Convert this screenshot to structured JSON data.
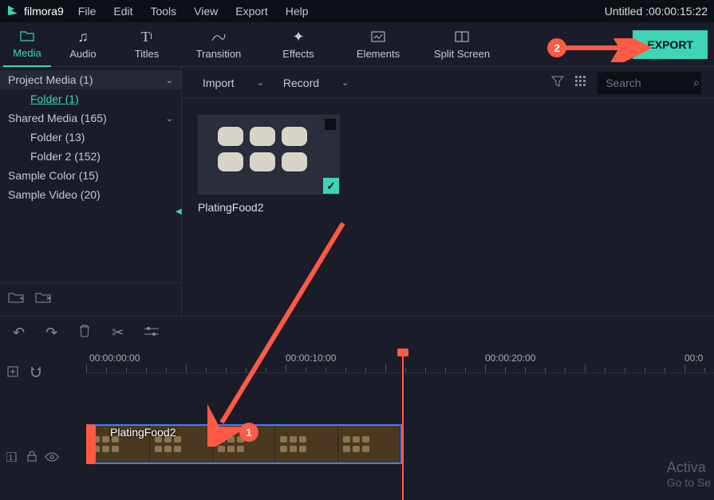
{
  "app": {
    "name": "filmora9"
  },
  "menu": [
    "File",
    "Edit",
    "Tools",
    "View",
    "Export",
    "Help"
  ],
  "title": "Untitled :00:00:15:22",
  "tools": [
    {
      "label": "Media",
      "icon": "folder"
    },
    {
      "label": "Audio",
      "icon": "music"
    },
    {
      "label": "Titles",
      "icon": "titles"
    },
    {
      "label": "Transition",
      "icon": "transition"
    },
    {
      "label": "Effects",
      "icon": "effects"
    },
    {
      "label": "Elements",
      "icon": "elements"
    },
    {
      "label": "Split Screen",
      "icon": "split"
    }
  ],
  "export_label": "EXPORT",
  "tree": {
    "project": "Project Media (1)",
    "project_child": "Folder (1)",
    "shared": "Shared Media (165)",
    "shared_c1": "Folder (13)",
    "shared_c2": "Folder 2 (152)",
    "sample_color": "Sample Color (15)",
    "sample_video": "Sample Video (20)"
  },
  "content": {
    "import": "Import",
    "record": "Record",
    "search_ph": "Search",
    "clip_name": "PlatingFood2"
  },
  "ruler": {
    "t0": "00:00:00:00",
    "t1": "00:00:10:00",
    "t2": "00:00:20:00",
    "t3": "00:0"
  },
  "timeline_clip": "PlatingFood2",
  "watermark": {
    "l1": "Activa",
    "l2": "Go to Se"
  },
  "anno": {
    "b1": "1",
    "b2": "2"
  }
}
